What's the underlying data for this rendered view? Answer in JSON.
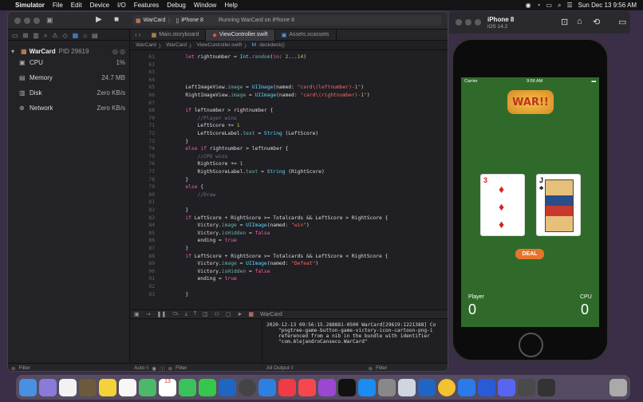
{
  "menubar": {
    "apple": "",
    "items": [
      "Simulator",
      "File",
      "Edit",
      "Device",
      "I/O",
      "Features",
      "Debug",
      "Window",
      "Help"
    ],
    "clock": "Sun Dec 13  9:56 AM"
  },
  "toolbar": {
    "scheme": "WarCard",
    "destination": "iPhone 8",
    "status": "Running WarCard on iPhone 8"
  },
  "debug_navigator": {
    "process": "WarCard",
    "pid": "PID 29619",
    "gauges": [
      {
        "label": "CPU",
        "value": "1%"
      },
      {
        "label": "Memory",
        "value": "24.7 MB"
      },
      {
        "label": "Disk",
        "value": "Zero KB/s"
      },
      {
        "label": "Network",
        "value": "Zero KB/s"
      }
    ]
  },
  "tabs": [
    {
      "label": "Main.storyboard",
      "active": false
    },
    {
      "label": "ViewController.swift",
      "active": true
    },
    {
      "label": "Assets.xcassets",
      "active": false
    }
  ],
  "jumpbar": [
    "WarCard",
    "WarCard",
    "ViewController.swift",
    "M",
    "deckdeck()"
  ],
  "code": {
    "lines": [
      {
        "n": "61",
        "t": "        let rightnumber = Int.random(in: 2...14)"
      },
      {
        "n": "62",
        "t": ""
      },
      {
        "n": "63",
        "t": ""
      },
      {
        "n": "64",
        "t": ""
      },
      {
        "n": "65",
        "t": "        LeftImageView.image = UIImage(named: \"card\\(leftnumber)-1\")"
      },
      {
        "n": "66",
        "t": "        RightImageView.image = UIImage(named: \"card\\(rightnumber)-1\")"
      },
      {
        "n": "67",
        "t": ""
      },
      {
        "n": "68",
        "t": "        if leftnumber > rightnumber {"
      },
      {
        "n": "70",
        "t": "            //Player wins"
      },
      {
        "n": "71",
        "t": "            LeftScore += 1"
      },
      {
        "n": "72",
        "t": "            LeftScoreLabel.text = String (LeftScore)"
      },
      {
        "n": "73",
        "t": "        }"
      },
      {
        "n": "74",
        "t": "        else if rightnumber > leftnumber {"
      },
      {
        "n": "75",
        "t": "            //CPU wins"
      },
      {
        "n": "76",
        "t": "            RightScore += 1"
      },
      {
        "n": "77",
        "t": "            RigthScoreLabel.text = String (RightScore)"
      },
      {
        "n": "78",
        "t": "        }"
      },
      {
        "n": "79",
        "t": "        else {"
      },
      {
        "n": "80",
        "t": "            //Draw"
      },
      {
        "n": "81",
        "t": ""
      },
      {
        "n": "82",
        "t": "        }"
      },
      {
        "n": "83",
        "t": "        if LeftScore + RightScore >= Totalcards && LeftScore > RightScore {"
      },
      {
        "n": "84",
        "t": "            Victory.image = UIImage(named: \"win\")"
      },
      {
        "n": "85",
        "t": "            Victory.isHidden = false"
      },
      {
        "n": "86",
        "t": "            ending = true"
      },
      {
        "n": "87",
        "t": "        }"
      },
      {
        "n": "88",
        "t": "        if LeftScore + RightScore >= Totalcards && LeftScore < RightScore {"
      },
      {
        "n": "89",
        "t": "            Victory.image = UIImage(named: \"Defeat\")"
      },
      {
        "n": "90",
        "t": "            Victory.isHidden = false"
      },
      {
        "n": "91",
        "t": "            ending = true"
      },
      {
        "n": "92",
        "t": ""
      },
      {
        "n": "93",
        "t": "        }"
      }
    ]
  },
  "debug_bar": {
    "target": "WarCard"
  },
  "console": {
    "text": "2020-12-13 09:56:15.288881-0500 WarCard[29619:1221388] Co\n    \"pngtree-game-button-game-victory-icon-cartoon-png-i\n    referenced from a nib in the bundle with identifier\n    \"com.AlejandroCanseco.WarCard\""
  },
  "bottom": {
    "filter_left": "Filter",
    "auto": "Auto ◊",
    "filter_mid": "Filter",
    "all_output": "All Output ◊",
    "filter_right": "Filter"
  },
  "simulator": {
    "device": "iPhone 8",
    "os": "iOS 14.2",
    "status": {
      "carrier": "Carrier",
      "time": "9:56 AM"
    },
    "logo": "WAR!!",
    "deal_label": "DEAL",
    "left_card": {
      "rank": "3",
      "suit": "♦"
    },
    "right_card": {
      "rank": "J",
      "suit": "♣"
    },
    "player_label": "Player",
    "cpu_label": "CPU",
    "player_score": "0",
    "cpu_score": "0"
  },
  "colors": {
    "felt": "#2f6a2a",
    "accent": "#1a73e8"
  }
}
